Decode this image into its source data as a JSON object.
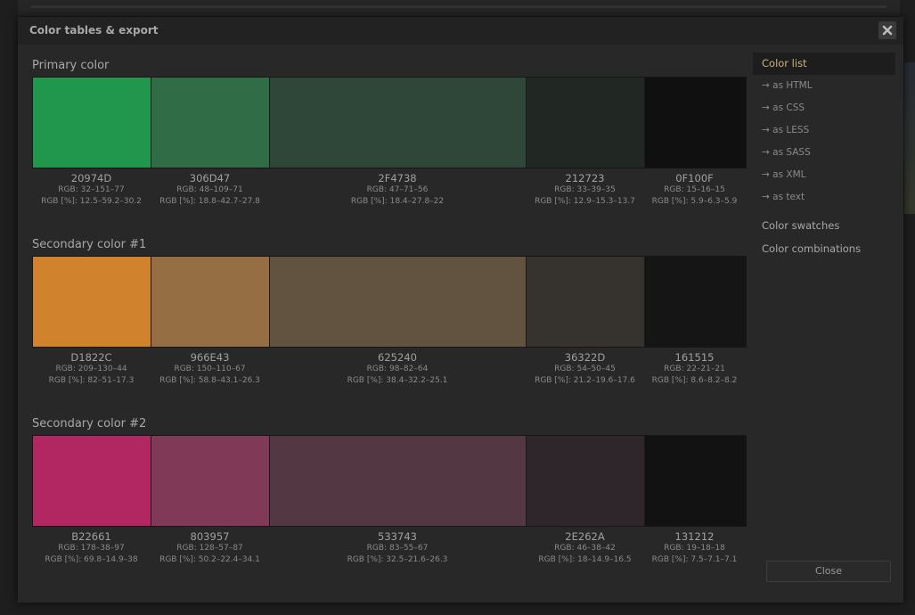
{
  "dialog": {
    "title": "Color tables & export",
    "close_label": "Close"
  },
  "sidebar": {
    "active": "Color list",
    "sub_items": [
      "→ as HTML",
      "→ as CSS",
      "→ as LESS",
      "→ as SASS",
      "→ as XML",
      "→ as text"
    ],
    "groups": [
      "Color swatches",
      "Color combinations"
    ]
  },
  "sections": [
    {
      "title": "Primary color",
      "colors": [
        {
          "hex": "20974D",
          "color": "#20974D",
          "rgb": "RGB: 32–151–77",
          "rgbp": "RGB [%]: 12.5–59.2–30.2"
        },
        {
          "hex": "306D47",
          "color": "#306D47",
          "rgb": "RGB: 48–109–71",
          "rgbp": "RGB [%]: 18.8–42.7–27.8"
        },
        {
          "hex": "2F4738",
          "color": "#2F4738",
          "rgb": "RGB: 47–71–56",
          "rgbp": "RGB [%]: 18.4–27.8–22"
        },
        {
          "hex": "212723",
          "color": "#212723",
          "rgb": "RGB: 33–39–35",
          "rgbp": "RGB [%]: 12.9–15.3–13.7"
        },
        {
          "hex": "0F100F",
          "color": "#0F100F",
          "rgb": "RGB: 15–16–15",
          "rgbp": "RGB [%]: 5.9–6.3–5.9"
        }
      ]
    },
    {
      "title": "Secondary color #1",
      "colors": [
        {
          "hex": "D1822C",
          "color": "#D1822C",
          "rgb": "RGB: 209–130–44",
          "rgbp": "RGB [%]: 82–51–17.3"
        },
        {
          "hex": "966E43",
          "color": "#966E43",
          "rgb": "RGB: 150–110–67",
          "rgbp": "RGB [%]: 58.8–43.1–26.3"
        },
        {
          "hex": "625240",
          "color": "#625240",
          "rgb": "RGB: 98–82–64",
          "rgbp": "RGB [%]: 38.4–32.2–25.1"
        },
        {
          "hex": "36322D",
          "color": "#36322D",
          "rgb": "RGB: 54–50–45",
          "rgbp": "RGB [%]: 21.2–19.6–17.6"
        },
        {
          "hex": "161515",
          "color": "#161515",
          "rgb": "RGB: 22–21–21",
          "rgbp": "RGB [%]: 8.6–8.2–8.2"
        }
      ]
    },
    {
      "title": "Secondary color #2",
      "colors": [
        {
          "hex": "B22661",
          "color": "#B22661",
          "rgb": "RGB: 178–38–97",
          "rgbp": "RGB [%]: 69.8–14.9–38"
        },
        {
          "hex": "803957",
          "color": "#803957",
          "rgb": "RGB: 128–57–87",
          "rgbp": "RGB [%]: 50.2–22.4–34.1"
        },
        {
          "hex": "533743",
          "color": "#533743",
          "rgb": "RGB: 83–55–67",
          "rgbp": "RGB [%]: 32.5–21.6–26.3"
        },
        {
          "hex": "2E262A",
          "color": "#2E262A",
          "rgb": "RGB: 46–38–42",
          "rgbp": "RGB [%]: 18–14.9–16.5"
        },
        {
          "hex": "131212",
          "color": "#131212",
          "rgb": "RGB: 19–18–18",
          "rgbp": "RGB [%]: 7.5–7.1–7.1"
        }
      ]
    }
  ]
}
